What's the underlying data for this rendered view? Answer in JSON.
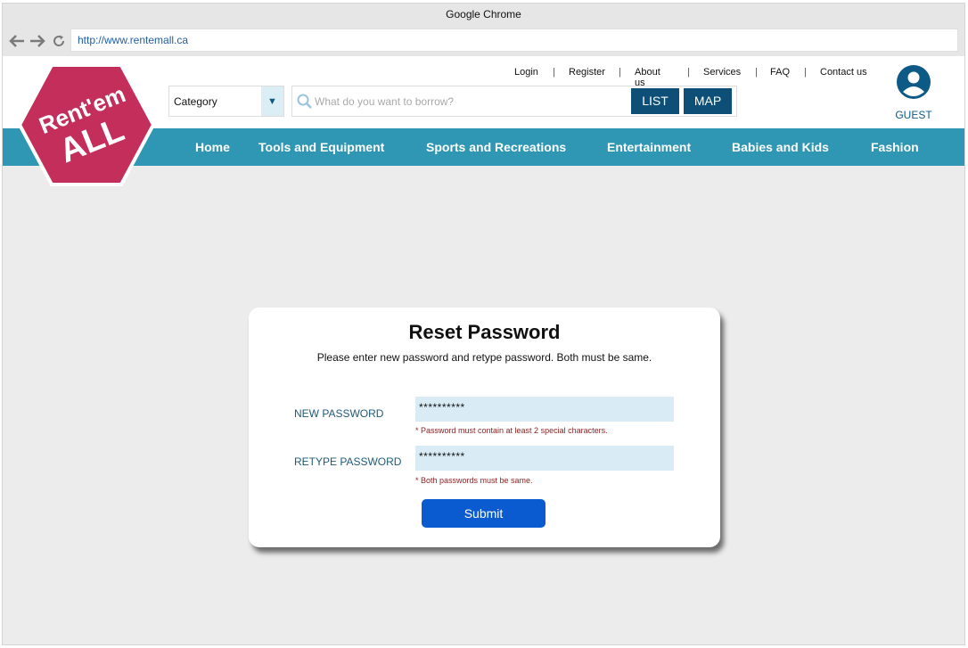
{
  "browser": {
    "title": "Google Chrome",
    "url": "http://www.rentemall.ca"
  },
  "logo": {
    "line1": "Rent'em",
    "line2": "ALL",
    "color": "#c42e5b"
  },
  "toplinks": [
    "Login",
    "Register",
    "About us",
    "Services",
    "FAQ",
    "Contact us"
  ],
  "search": {
    "category": "Category",
    "placeholder": "What do you want to borrow?",
    "list_label": "LIST",
    "map_label": "MAP"
  },
  "user": {
    "label": "GUEST"
  },
  "nav": [
    "Home",
    "Tools and Equipment",
    "Sports and Recreations",
    "Entertainment",
    "Babies and Kids",
    "Fashion"
  ],
  "form": {
    "title": "Reset Password",
    "subtitle": "Please enter new password and retype password. Both must be same.",
    "new_password_label": "NEW PASSWORD",
    "new_password_value": "**********",
    "new_password_error": "* Password must contain at least 2 special characters.",
    "retype_password_label": "RETYPE PASSWORD",
    "retype_password_value": "**********",
    "retype_password_error": "* Both passwords must be same.",
    "submit_label": "Submit"
  },
  "colors": {
    "nav": "#2f97b4",
    "button_dark": "#0d4f76",
    "submit": "#0b5bd0"
  }
}
